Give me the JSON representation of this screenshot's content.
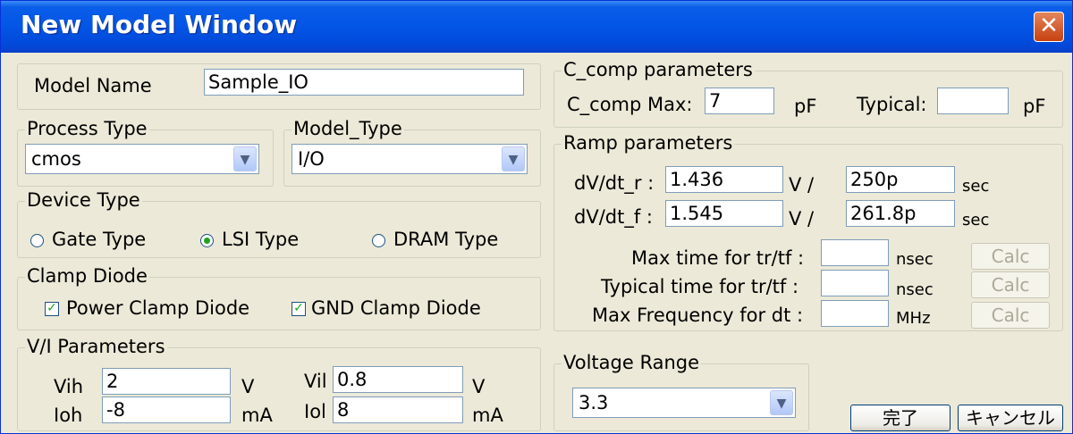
{
  "window": {
    "title": "New Model Window",
    "close_glyph": "✕"
  },
  "model_name": {
    "label": "Model Name",
    "value": "Sample_IO"
  },
  "process_type": {
    "legend": "Process Type",
    "selected": "cmos"
  },
  "model_type": {
    "legend": "Model_Type",
    "selected": "I/O"
  },
  "device_type": {
    "legend": "Device Type",
    "options": [
      {
        "label": "Gate Type",
        "checked": false
      },
      {
        "label": "LSI Type",
        "checked": true
      },
      {
        "label": "DRAM Type",
        "checked": false
      }
    ]
  },
  "clamp_diode": {
    "legend": "Clamp Diode",
    "power": {
      "label": "Power Clamp Diode",
      "checked": true,
      "mark": "✓"
    },
    "gnd": {
      "label": "GND Clamp Diode",
      "checked": true,
      "mark": "✓"
    }
  },
  "vi_params": {
    "legend": "V/I Parameters",
    "vih": {
      "label": "Vih",
      "value": "2",
      "unit": "V"
    },
    "ioh": {
      "label": "Ioh",
      "value": "-8",
      "unit": "mA"
    },
    "vil": {
      "label": "Vil",
      "value": "0.8",
      "unit": "V"
    },
    "iol": {
      "label": "Iol",
      "value": "8",
      "unit": "mA"
    }
  },
  "c_comp": {
    "legend": "C_comp parameters",
    "max_label": "C_comp Max:",
    "max_value": "7",
    "max_unit": "pF",
    "typ_label": "Typical:",
    "typ_value": "",
    "typ_unit": "pF"
  },
  "ramp": {
    "legend": "Ramp parameters",
    "r_label": "dV/dt_r :",
    "r_v": "1.436",
    "r_unit_v": "V /",
    "r_t": "250p",
    "r_unit_t": "sec",
    "f_label": "dV/dt_f :",
    "f_v": "1.545",
    "f_unit_v": "V /",
    "f_t": "261.8p",
    "f_unit_t": "sec",
    "max_time": {
      "label": "Max time for tr/tf :",
      "value": "",
      "unit": "nsec",
      "button": "Calc"
    },
    "typ_time": {
      "label": "Typical time for tr/tf :",
      "value": "",
      "unit": "nsec",
      "button": "Calc"
    },
    "max_freq": {
      "label": "Max Frequency for dt :",
      "value": "",
      "unit": "MHz",
      "button": "Calc"
    }
  },
  "voltage_range": {
    "legend": "Voltage Range",
    "selected": "3.3"
  },
  "buttons": {
    "ok": "完了",
    "cancel": "キャンセル"
  },
  "icons": {
    "dropdown": "▼"
  }
}
